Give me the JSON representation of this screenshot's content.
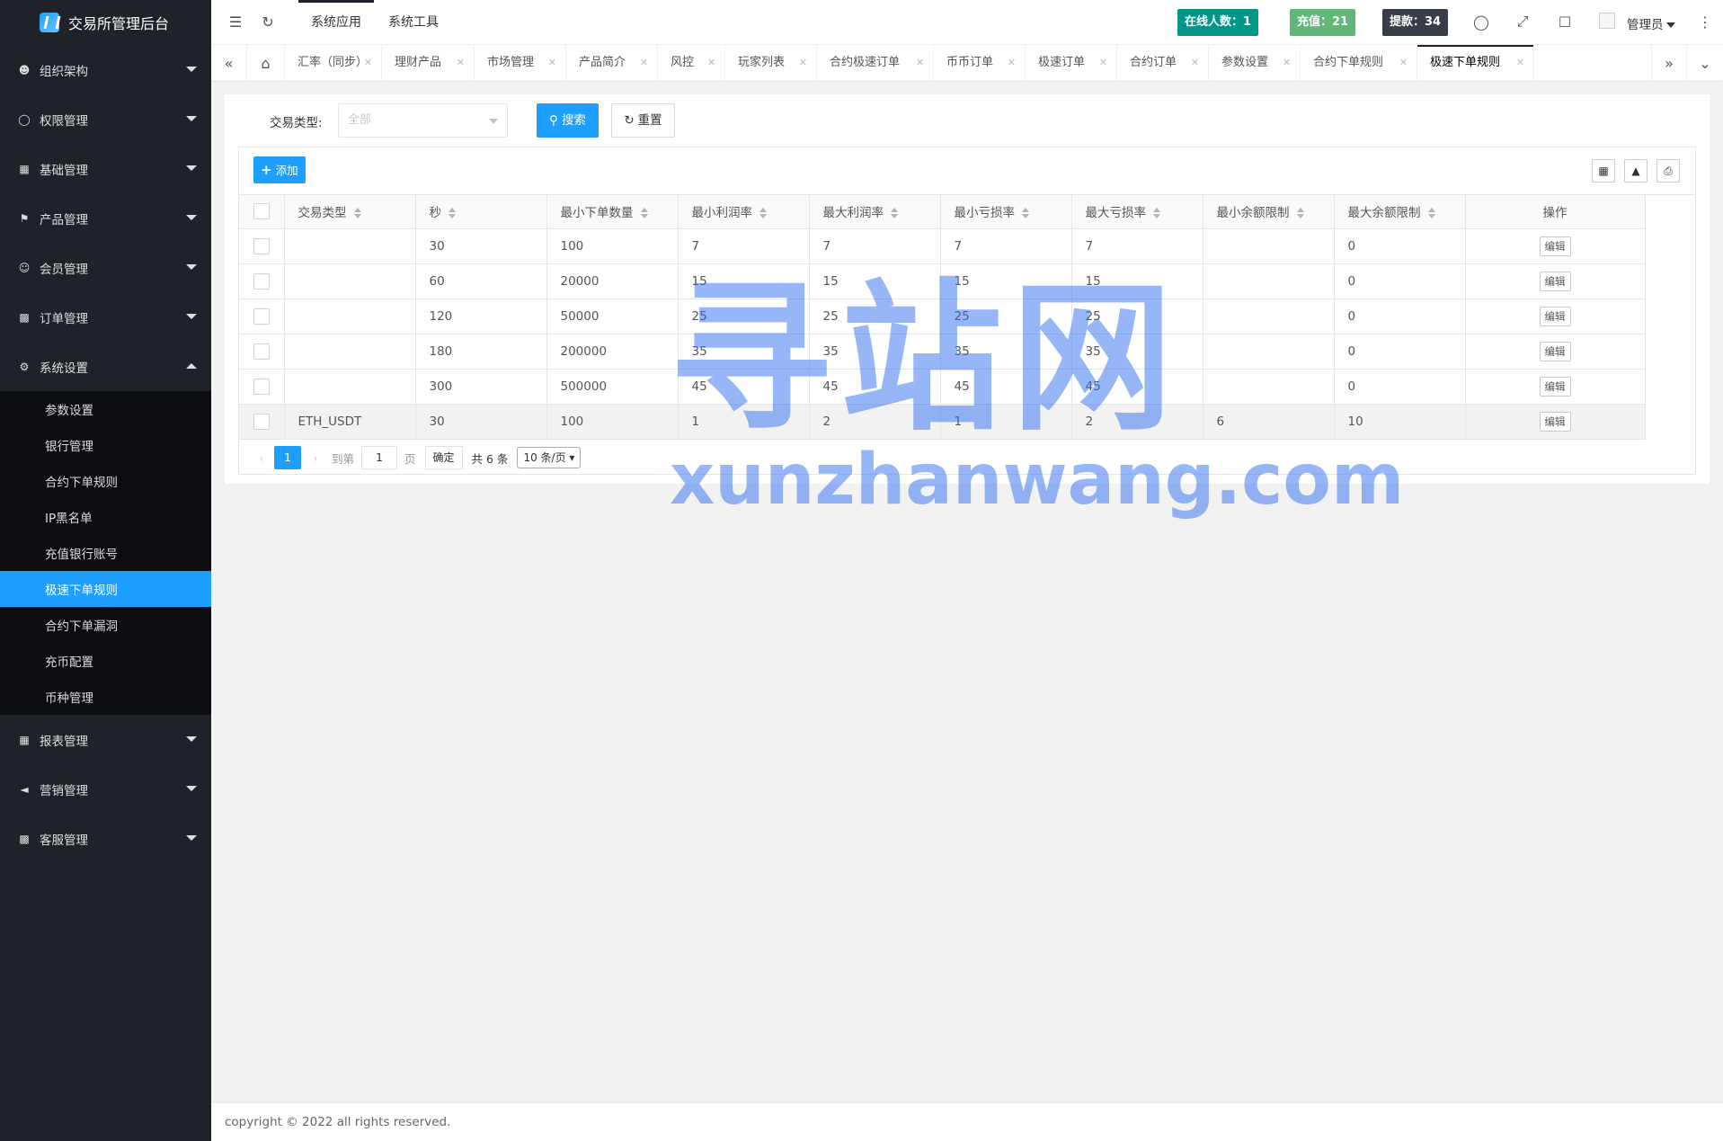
{
  "app": {
    "title": "交易所管理后台"
  },
  "sidebar": {
    "menu": [
      {
        "label": "组织架构",
        "icon": "users-icon"
      },
      {
        "label": "权限管理",
        "icon": "shield-icon"
      },
      {
        "label": "基础管理",
        "icon": "grid-icon"
      },
      {
        "label": "产品管理",
        "icon": "flag-icon"
      },
      {
        "label": "会员管理",
        "icon": "user-icon"
      },
      {
        "label": "订单管理",
        "icon": "apps-icon"
      },
      {
        "label": "系统设置",
        "icon": "gear-icon"
      }
    ],
    "submenu": [
      "参数设置",
      "银行管理",
      "合约下单规则",
      "IP黑名单",
      "充值银行账号",
      "极速下单规则",
      "合约下单漏洞",
      "充币配置",
      "币种管理"
    ],
    "menu_bottom": [
      {
        "label": "报表管理",
        "icon": "report-icon"
      },
      {
        "label": "营销管理",
        "icon": "speaker-icon"
      },
      {
        "label": "客服管理",
        "icon": "apps-icon"
      }
    ]
  },
  "header": {
    "tabs": [
      "系统应用",
      "系统工具"
    ],
    "badges": [
      {
        "label": "在线人数：1",
        "color": "#009688"
      },
      {
        "label": "充值：21",
        "color": "#5fb878"
      },
      {
        "label": "提款：34",
        "color": "#393d49"
      }
    ],
    "user": "管理员"
  },
  "page_tabs": [
    "汇率（同步）",
    "理财产品",
    "市场管理",
    "产品简介",
    "风控",
    "玩家列表",
    "合约极速订单",
    "币币订单",
    "极速订单",
    "合约订单",
    "参数设置",
    "合约下单规则",
    "极速下单规则"
  ],
  "search": {
    "type_label": "交易类型:",
    "type_placeholder": "全部",
    "search_btn": "搜索",
    "reset_btn": "重置"
  },
  "table": {
    "add_btn": "添加",
    "columns": [
      "交易类型",
      "秒",
      "最小下单数量",
      "最小利润率",
      "最大利润率",
      "最小亏损率",
      "最大亏损率",
      "最小余额限制",
      "最大余额限制",
      "操作"
    ],
    "edit_label": "编辑",
    "rows": [
      [
        "",
        "30",
        "100",
        "7",
        "7",
        "7",
        "7",
        "",
        "0"
      ],
      [
        "",
        "60",
        "20000",
        "15",
        "15",
        "15",
        "15",
        "",
        "0"
      ],
      [
        "",
        "120",
        "50000",
        "25",
        "25",
        "25",
        "25",
        "",
        "0"
      ],
      [
        "",
        "180",
        "200000",
        "35",
        "35",
        "35",
        "35",
        "",
        "0"
      ],
      [
        "",
        "300",
        "500000",
        "45",
        "45",
        "45",
        "45",
        "",
        "0"
      ],
      [
        "ETH_USDT",
        "30",
        "100",
        "1",
        "2",
        "1",
        "2",
        "6",
        "10"
      ]
    ]
  },
  "pager": {
    "current": "1",
    "goto_label": "到第",
    "goto_value": "1",
    "page_unit": "页",
    "confirm": "确定",
    "total": "共 6 条",
    "page_size": "10 条/页"
  },
  "footer": {
    "copyright": "copyright © 2022 all rights reserved."
  },
  "watermark": {
    "title": "寻站网",
    "url": "xunzhanwang.com"
  }
}
